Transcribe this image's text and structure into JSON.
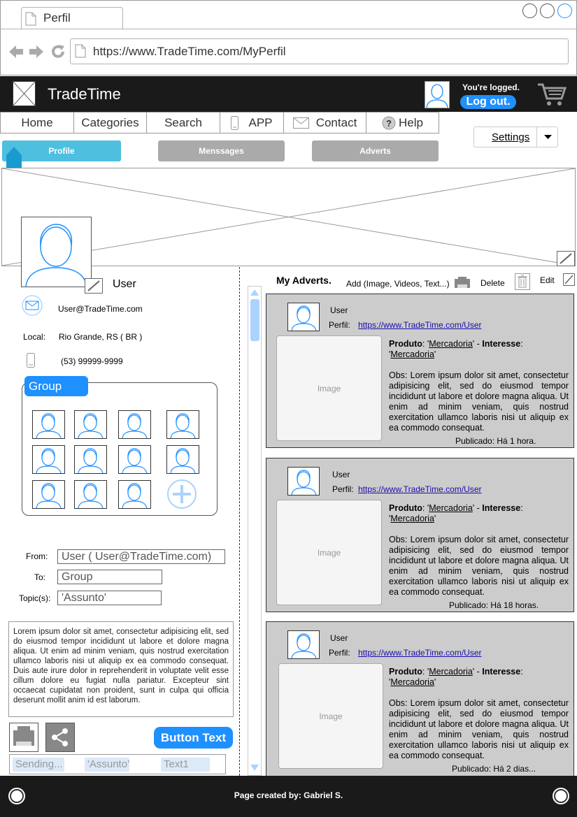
{
  "browser": {
    "tab_title": "Perfil",
    "url": "https://www.TradeTime.com/MyPerfil"
  },
  "header": {
    "brand": "TradeTime",
    "logged_text": "You're logged.",
    "logout_label": "Log out."
  },
  "nav": {
    "items": [
      "Home",
      "Categories",
      "Search",
      "APP",
      "Contact",
      "Help"
    ],
    "settings_label": "Settings"
  },
  "subtabs": {
    "profile": "Profile",
    "messages": "Menssages",
    "adverts": "Adverts"
  },
  "profile": {
    "name": "User",
    "email": "User@TradeTime.com",
    "local_label": "Local:",
    "local_value": "Rio Grande, RS ( BR )",
    "phone": "(53) 99999-9999",
    "group_label": "Group"
  },
  "message": {
    "from_label": "From:",
    "from_value": "User ( User@TradeTime.com)",
    "to_label": "To:",
    "to_value": "Group",
    "topic_label": "Topic(s):",
    "topic_value": "'Assunto'",
    "body": "Lorem ipsum dolor sit amet, consectetur adipisicing elit, sed do eiusmod tempor incididunt ut labore et dolore magna aliqua. Ut enim ad minim veniam, quis nostrud exercitation ullamco laboris nisi ut aliquip ex ea commodo consequat. Duis aute irure dolor in reprehenderit in voluptate velit esse cillum dolore eu fugiat nulla pariatur. Excepteur sint occaecat cupidatat non proident, sunt in culpa qui officia deserunt mollit anim id est laborum.",
    "button_label": "Button Text",
    "status": [
      "Sending...",
      "'Assunto'",
      "Text1"
    ]
  },
  "adverts": {
    "title": "My Adverts.",
    "add_label": "Add (Image, Videos, Text...)",
    "delete_label": "Delete",
    "edit_label": "Edit",
    "items": [
      {
        "user": "User",
        "perfil_label": "Perfil:",
        "link": "https://www.TradeTime.com/User",
        "image_label": "Image",
        "produto_label": "Produto",
        "produto_value": "Mercadoria",
        "interesse_label": "Interesse",
        "interesse_value": "Mercadoria",
        "obs": "Obs: Lorem ipsum dolor sit amet, consectetur adipisicing elit, sed do eiusmod tempor incididunt ut labore et dolore magna aliqua. Ut enim ad minim veniam, quis nostrud exercitation ullamco laboris nisi ut aliquip ex ea commodo consequat.",
        "published": "Publicado: Há 1 hora."
      },
      {
        "user": "User",
        "perfil_label": "Perfil:",
        "link": "https://www.TradeTime.com/User",
        "image_label": "Image",
        "produto_label": "Produto",
        "produto_value": "Mercadoria",
        "interesse_label": "Interesse",
        "interesse_value": "Mercadoria",
        "obs": "Obs: Lorem ipsum dolor sit amet, consectetur adipisicing elit, sed do eiusmod tempor incididunt ut labore et dolore magna aliqua. Ut enim ad minim veniam, quis nostrud exercitation ullamco laboris nisi ut aliquip ex ea commodo consequat.",
        "published": "Publicado: Há 18 horas."
      },
      {
        "user": "User",
        "perfil_label": "Perfil:",
        "link": "https://www.TradeTime.com/User",
        "image_label": "Image",
        "produto_label": "Produto",
        "produto_value": "Mercadoria",
        "interesse_label": "Interesse",
        "interesse_value": "Mercadoria",
        "obs": "Obs: Lorem ipsum dolor sit amet, consectetur adipisicing elit, sed do eiusmod tempor incididunt ut labore et dolore magna aliqua. Ut enim ad minim veniam, quis nostrud exercitation ullamco laboris nisi ut aliquip ex ea commodo consequat.",
        "published": "Publicado: Há 2  dias..."
      }
    ]
  },
  "footer": {
    "credit": "Page created by: Gabriel S."
  },
  "colors": {
    "accent": "#1e90ff",
    "profile_tab": "#4fbfe0",
    "inactive_tab": "#aaaaaa",
    "dark": "#1a1a1a",
    "card_bg": "#cccccc"
  }
}
